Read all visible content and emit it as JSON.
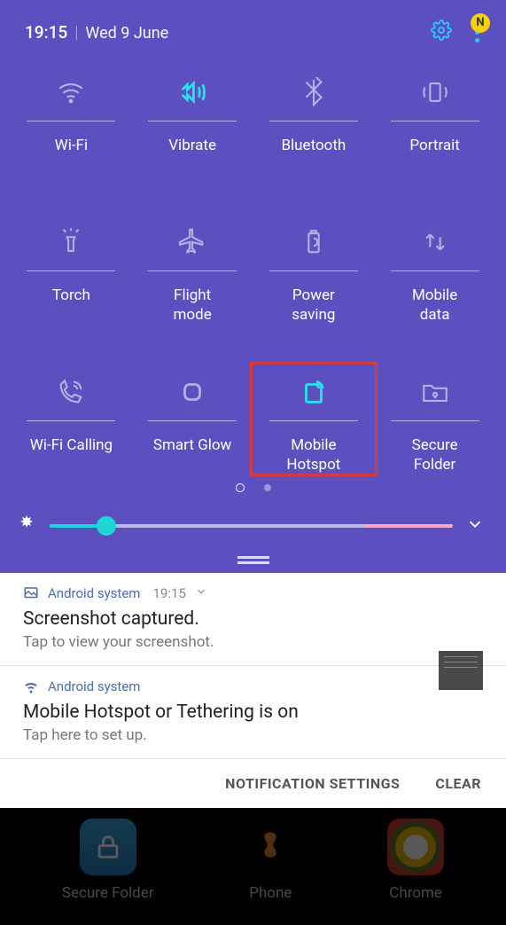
{
  "status": {
    "time": "19:15",
    "date": "Wed 9 June",
    "avatar_letter": "N"
  },
  "tiles": [
    {
      "label": "Wi-Fi",
      "state": "inactive"
    },
    {
      "label": "Vibrate",
      "state": "active"
    },
    {
      "label": "Bluetooth",
      "state": "inactive"
    },
    {
      "label": "Portrait",
      "state": "inactive"
    },
    {
      "label": "Torch",
      "state": "inactive"
    },
    {
      "label": "Flight\nmode",
      "state": "inactive"
    },
    {
      "label": "Power\nsaving",
      "state": "inactive"
    },
    {
      "label": "Mobile\ndata",
      "state": "inactive"
    },
    {
      "label": "Wi-Fi Calling",
      "state": "inactive"
    },
    {
      "label": "Smart Glow",
      "state": "inactive"
    },
    {
      "label": "Mobile\nHotspot",
      "state": "active",
      "highlighted": true
    },
    {
      "label": "Secure\nFolder",
      "state": "inactive"
    }
  ],
  "brightness": {
    "value_pct": 14
  },
  "notifications": [
    {
      "app": "Android system",
      "time": "19:15",
      "title": "Screenshot captured.",
      "subtitle": "Tap to view your screenshot.",
      "has_thumb": true,
      "expandable": true
    },
    {
      "app": "Android system",
      "title": "Mobile Hotspot or Tethering is on",
      "subtitle": "Tap here to set up."
    }
  ],
  "actions": {
    "settings": "NOTIFICATION SETTINGS",
    "clear": "CLEAR"
  },
  "home_apps": [
    {
      "label": "Secure Folder"
    },
    {
      "label": "Phone"
    },
    {
      "label": "Chrome"
    }
  ]
}
